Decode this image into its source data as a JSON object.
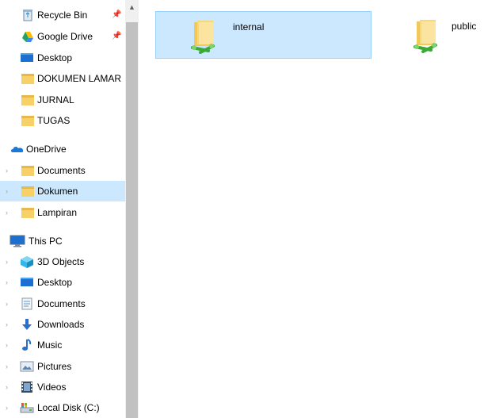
{
  "nav": {
    "quick_access": [
      {
        "label": "Recycle Bin",
        "icon": "recycle-bin-icon",
        "pinned": true
      },
      {
        "label": "Google Drive",
        "icon": "google-drive-icon",
        "pinned": true
      },
      {
        "label": "Desktop",
        "icon": "desktop-icon",
        "pinned": false
      },
      {
        "label": "DOKUMEN LAMAR",
        "icon": "folder-icon",
        "pinned": false
      },
      {
        "label": "JURNAL",
        "icon": "folder-icon",
        "pinned": false
      },
      {
        "label": "TUGAS",
        "icon": "folder-icon",
        "pinned": false
      }
    ],
    "onedrive": {
      "label": "OneDrive",
      "items": [
        {
          "label": "Documents"
        },
        {
          "label": "Dokumen"
        },
        {
          "label": "Lampiran"
        }
      ]
    },
    "this_pc": {
      "label": "This PC",
      "items": [
        {
          "label": "3D Objects",
          "icon": "3d-objects-icon"
        },
        {
          "label": "Desktop",
          "icon": "desktop-icon"
        },
        {
          "label": "Documents",
          "icon": "documents-icon"
        },
        {
          "label": "Downloads",
          "icon": "downloads-icon"
        },
        {
          "label": "Music",
          "icon": "music-icon"
        },
        {
          "label": "Pictures",
          "icon": "pictures-icon"
        },
        {
          "label": "Videos",
          "icon": "videos-icon"
        },
        {
          "label": "Local Disk (C:)",
          "icon": "local-disk-icon"
        }
      ]
    }
  },
  "files": [
    {
      "label": "internal",
      "selected": true
    },
    {
      "label": "public",
      "selected": false
    }
  ],
  "colors": {
    "selection_bg": "#cce8ff",
    "selection_border": "#99d1ff",
    "folder": "#f7d168",
    "share_green": "#3aa936"
  }
}
